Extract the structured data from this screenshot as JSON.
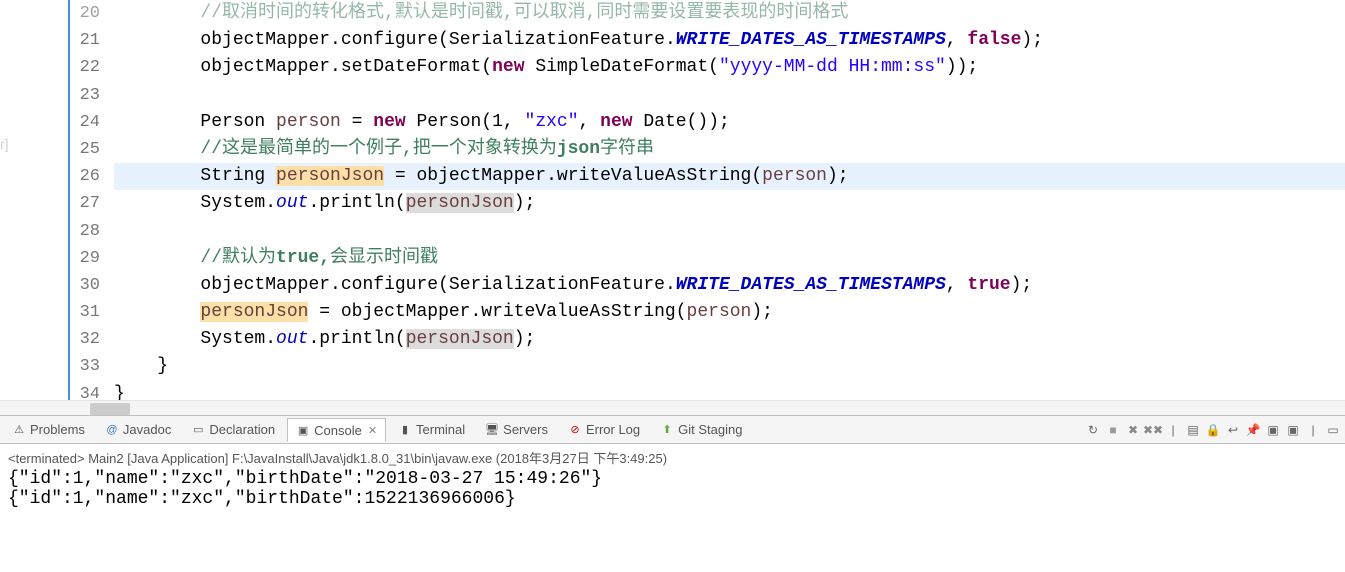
{
  "sidebar_fragment": "r]",
  "gutter": {
    "start": 20,
    "end": 34
  },
  "code": {
    "l20": {
      "comment": "//取消时间的转化格式,默认是时间戳,可以取消,同时需要设置要表现的时间格式"
    },
    "l21": {
      "obj": "objectMapper",
      "method": "configure",
      "clazz": "SerializationFeature",
      "constant": "WRITE_DATES_AS_TIMESTAMPS",
      "kw": "false"
    },
    "l22": {
      "obj": "objectMapper",
      "method": "setDateFormat",
      "kw": "new",
      "ctor": "SimpleDateFormat",
      "str": "\"yyyy-MM-dd HH:mm:ss\""
    },
    "l24": {
      "type": "Person",
      "var": "person",
      "kw": "new",
      "ctor": "Person",
      "arg1": "1",
      "arg2": "\"zxc\"",
      "kw2": "new",
      "ctor2": "Date"
    },
    "l25": {
      "prefix": "//这是最简单的一个例子,把一个对象转换为",
      "json": "json",
      "suffix": "字符串"
    },
    "l26": {
      "type": "String",
      "var": "personJson",
      "obj": "objectMapper",
      "method": "writeValueAsString",
      "arg": "person"
    },
    "l27": {
      "clazz": "System",
      "field": "out",
      "method": "println",
      "arg": "personJson"
    },
    "l29": {
      "prefix": "//默认为",
      "bold": "true,",
      "suffix": "会显示时间戳"
    },
    "l30": {
      "obj": "objectMapper",
      "method": "configure",
      "clazz": "SerializationFeature",
      "constant": "WRITE_DATES_AS_TIMESTAMPS",
      "kw": "true"
    },
    "l31": {
      "var": "personJson",
      "obj": "objectMapper",
      "method": "writeValueAsString",
      "arg": "person"
    },
    "l32": {
      "clazz": "System",
      "field": "out",
      "method": "println",
      "arg": "personJson"
    },
    "l33": {
      "brace": "}"
    },
    "l34": {
      "brace": "}"
    }
  },
  "tabs": {
    "problems": "Problems",
    "javadoc": "Javadoc",
    "declaration": "Declaration",
    "console": "Console",
    "terminal": "Terminal",
    "servers": "Servers",
    "errorlog": "Error Log",
    "gitstaging": "Git Staging"
  },
  "console": {
    "header": "<terminated> Main2 [Java Application] F:\\JavaInstall\\Java\\jdk1.8.0_31\\bin\\javaw.exe (2018年3月27日 下午3:49:25)",
    "line1": "{\"id\":1,\"name\":\"zxc\",\"birthDate\":\"2018-03-27 15:49:26\"}",
    "line2": "{\"id\":1,\"name\":\"zxc\",\"birthDate\":1522136966006}"
  },
  "toolbar_icons": [
    "↺",
    "■",
    "✖",
    "✖",
    "|",
    "▤",
    "▤",
    "▤",
    "▤",
    "▣",
    "▣",
    "|",
    "▤"
  ]
}
